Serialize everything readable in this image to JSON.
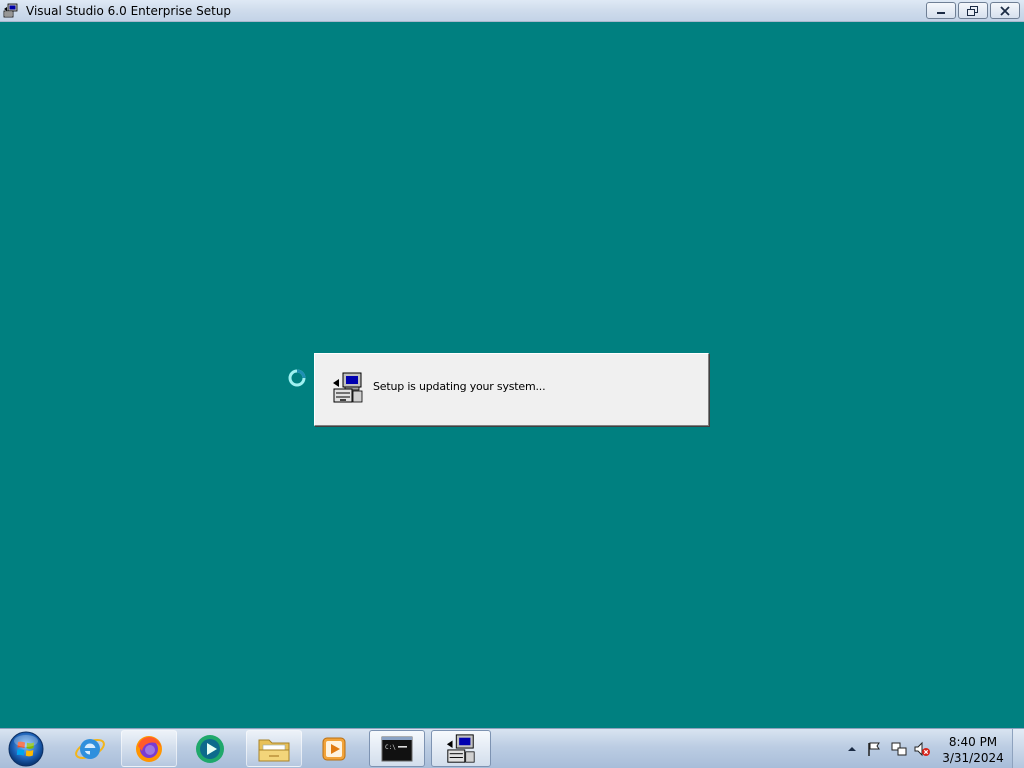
{
  "window": {
    "title": "Visual Studio 6.0 Enterprise Setup",
    "controls": [
      "minimize",
      "restore",
      "close"
    ]
  },
  "desktop": {
    "background_color": "#008080"
  },
  "dialog": {
    "message": "Setup is updating your system...",
    "icon": "setup-computer-icon"
  },
  "cursor": {
    "state": "busy-spinner-icon"
  },
  "taskbar": {
    "start_button": "windows-start-orb-icon",
    "items": [
      {
        "name": "internet-explorer",
        "icon": "internet-explorer-icon",
        "state": "unpinned"
      },
      {
        "name": "firefox",
        "icon": "firefox-icon",
        "state": "pinned"
      },
      {
        "name": "media-center",
        "icon": "media-center-icon",
        "state": "unpinned"
      },
      {
        "name": "file-explorer",
        "icon": "folder-icon",
        "state": "pinned"
      },
      {
        "name": "media-player",
        "icon": "media-player-icon",
        "state": "unpinned"
      },
      {
        "name": "command-prompt",
        "icon": "command-prompt-icon",
        "state": "running"
      },
      {
        "name": "setup",
        "icon": "setup-computer-icon",
        "state": "running-active"
      }
    ],
    "tray": {
      "icons": [
        "show-hidden-icons-arrow",
        "action-center-flag-icon",
        "network-icon",
        "volume-muted-icon"
      ],
      "time": "8:40 PM",
      "date": "3/31/2024"
    }
  }
}
